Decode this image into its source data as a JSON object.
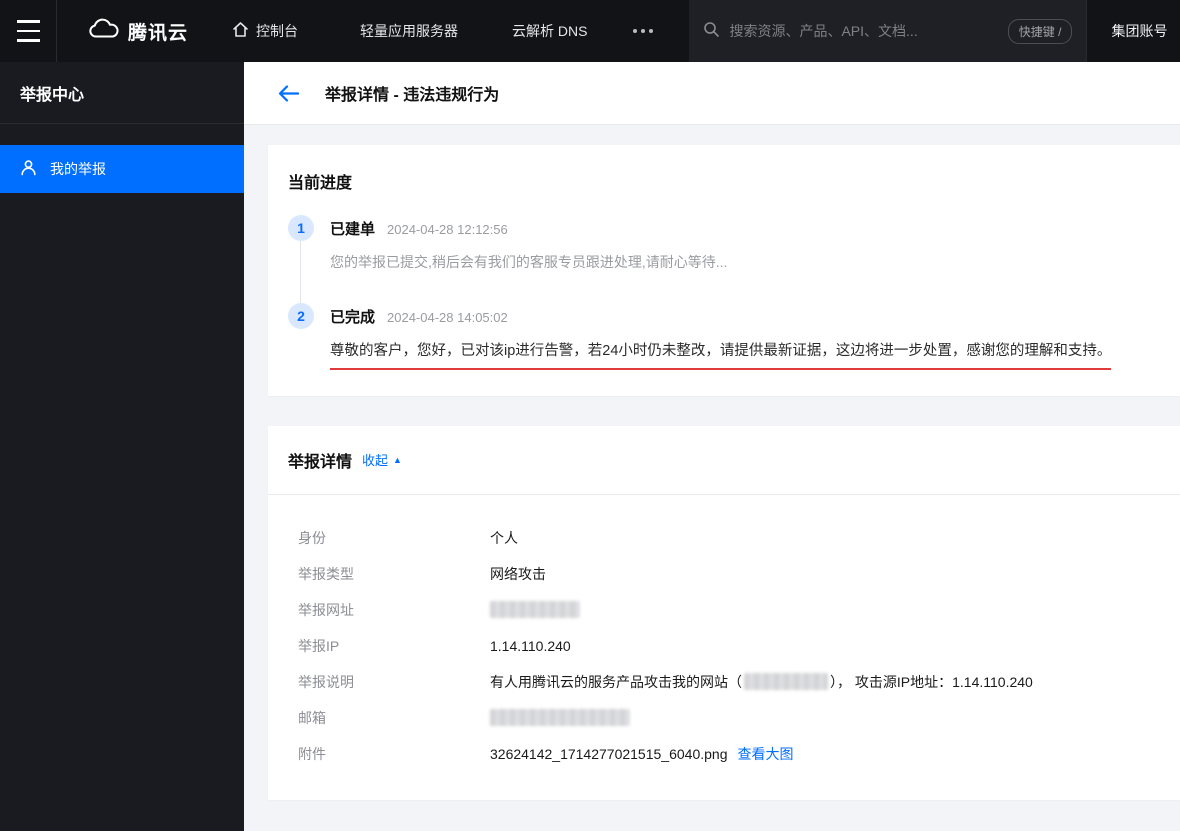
{
  "topbar": {
    "brand": "腾讯云",
    "console_label": "控制台",
    "nav": [
      {
        "label": "轻量应用服务器"
      },
      {
        "label": "云解析 DNS"
      }
    ],
    "search": {
      "placeholder": "搜索资源、产品、API、文档...",
      "shortcut_badge": "快捷键 /"
    },
    "account_label": "集团账号"
  },
  "sidebar": {
    "title": "举报中心",
    "items": [
      {
        "label": "我的举报",
        "active": true
      }
    ]
  },
  "page_header": {
    "title": "举报详情 - 违法违规行为"
  },
  "progress_card": {
    "title": "当前进度",
    "steps": [
      {
        "num": "1",
        "title": "已建单",
        "time": "2024-04-28 12:12:56",
        "desc": "您的举报已提交,稍后会有我们的客服专员跟进处理,请耐心等待..."
      },
      {
        "num": "2",
        "title": "已完成",
        "time": "2024-04-28 14:05:02",
        "desc": "尊敬的客户，您好，已对该ip进行告警，若24小时仍未整改，请提供最新证据，这边将进一步处置，感谢您的理解和支持。",
        "annotated": true
      }
    ]
  },
  "details_card": {
    "title": "举报详情",
    "collapse_label": "收起",
    "rows": [
      {
        "label": "身份",
        "value": "个人"
      },
      {
        "label": "举报类型",
        "value": "网络攻击"
      },
      {
        "label": "举报网址",
        "redacted": true
      },
      {
        "label": "举报IP",
        "value": "1.14.110.240"
      },
      {
        "label": "举报说明",
        "value_prefix": "有人用腾讯云的服务产品攻击我的网站（",
        "value_suffix": "）， 攻击源IP地址：1.14.110.240"
      },
      {
        "label": "邮箱",
        "redacted": true
      },
      {
        "label": "附件",
        "value": "32624142_1714277021515_6040.png",
        "link_label": "查看大图"
      }
    ]
  },
  "colors": {
    "accent": "#006eff",
    "active_item_bg": "#006eff",
    "annotation_red": "#e03b3b",
    "topbar_bg": "#121317",
    "sidebar_bg": "#1a1b20"
  }
}
